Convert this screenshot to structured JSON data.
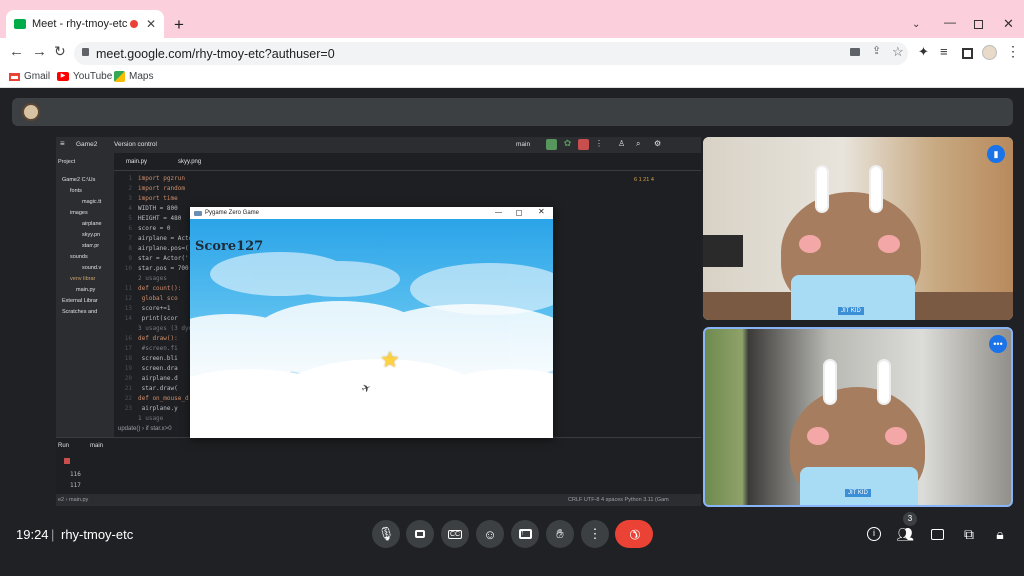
{
  "browser": {
    "tab_title": "Meet - rhy-tmoy-etc",
    "new_tab": "+",
    "url": "meet.google.com/rhy-tmoy-etc?authuser=0",
    "bookmarks": [
      {
        "label": "Gmail",
        "icon": "gmail-icon"
      },
      {
        "label": "YouTube",
        "icon": "youtube-icon"
      },
      {
        "label": "Maps",
        "icon": "maps-icon"
      }
    ],
    "colors": {
      "tab_strip": "#fbcfdc",
      "recording_dot": "#ea4335"
    }
  },
  "ide": {
    "project_name": "Game2",
    "version_control": "Version control",
    "branch": "main",
    "project_label": "Project",
    "tabs": [
      "main.py",
      "skyy.png"
    ],
    "tree": [
      "Game2  C:\\Us",
      "fonts",
      "magic.tt",
      "images",
      "airplane",
      "skyy.pn",
      "starr.pr",
      "sounds",
      "sound.v",
      "venv  librar",
      "main.py",
      "External Librar",
      "Scratches and"
    ],
    "code_lines": [
      {
        "n": "1",
        "text": "import pgzrun"
      },
      {
        "n": "2",
        "text": "import random"
      },
      {
        "n": "3",
        "text": "import time"
      },
      {
        "n": "4",
        "text": "WIDTH = 800"
      },
      {
        "n": "5",
        "text": "HEIGHT = 480"
      },
      {
        "n": "6",
        "text": "score = 0"
      },
      {
        "n": "7",
        "text": "airplane = Acto"
      },
      {
        "n": "8",
        "text": "airplane.pos=("
      },
      {
        "n": "9",
        "text": "star = Actor('"
      },
      {
        "n": "10",
        "text": "star.pos = 700"
      },
      {
        "n": "",
        "text": "2 usages"
      },
      {
        "n": "11",
        "text": "def count():"
      },
      {
        "n": "12",
        "text": "    global sco"
      },
      {
        "n": "13",
        "text": "    score+=1"
      },
      {
        "n": "14",
        "text": "    print(scor"
      },
      {
        "n": "",
        "text": "3 usages (3 dynam"
      },
      {
        "n": "16",
        "text": "def draw():"
      },
      {
        "n": "17",
        "text": "    #screen.fi"
      },
      {
        "n": "18",
        "text": "    screen.bli"
      },
      {
        "n": "19",
        "text": "    screen.dra"
      },
      {
        "n": "20",
        "text": "    airplane.d"
      },
      {
        "n": "21",
        "text": "    star.draw("
      },
      {
        "n": "22",
        "text": "def on_mouse_d"
      },
      {
        "n": "23",
        "text": "    airplane.y"
      },
      {
        "n": "",
        "text": "1 usage"
      }
    ],
    "inspections": "6  1  21  4",
    "breadcrumb": "update()  ›  if star.x>0",
    "run_label": "Run",
    "run_config": "main",
    "console_lines": [
      "116",
      "117",
      "118"
    ],
    "status_left": "e2  ›  main.py",
    "status_right": "CRLF   UTF-8   4 spaces   Python 3.11 (Gam"
  },
  "pygame": {
    "window_title": "Pygame Zero Game",
    "score_text": "Score127"
  },
  "participants": [
    {
      "label": "JIT KID"
    },
    {
      "label": "JIT KID"
    }
  ],
  "meet": {
    "time": "19:24",
    "separator": "|",
    "meeting_code": "rhy-tmoy-etc",
    "people_count": "3",
    "end_call_color": "#ea4335"
  }
}
